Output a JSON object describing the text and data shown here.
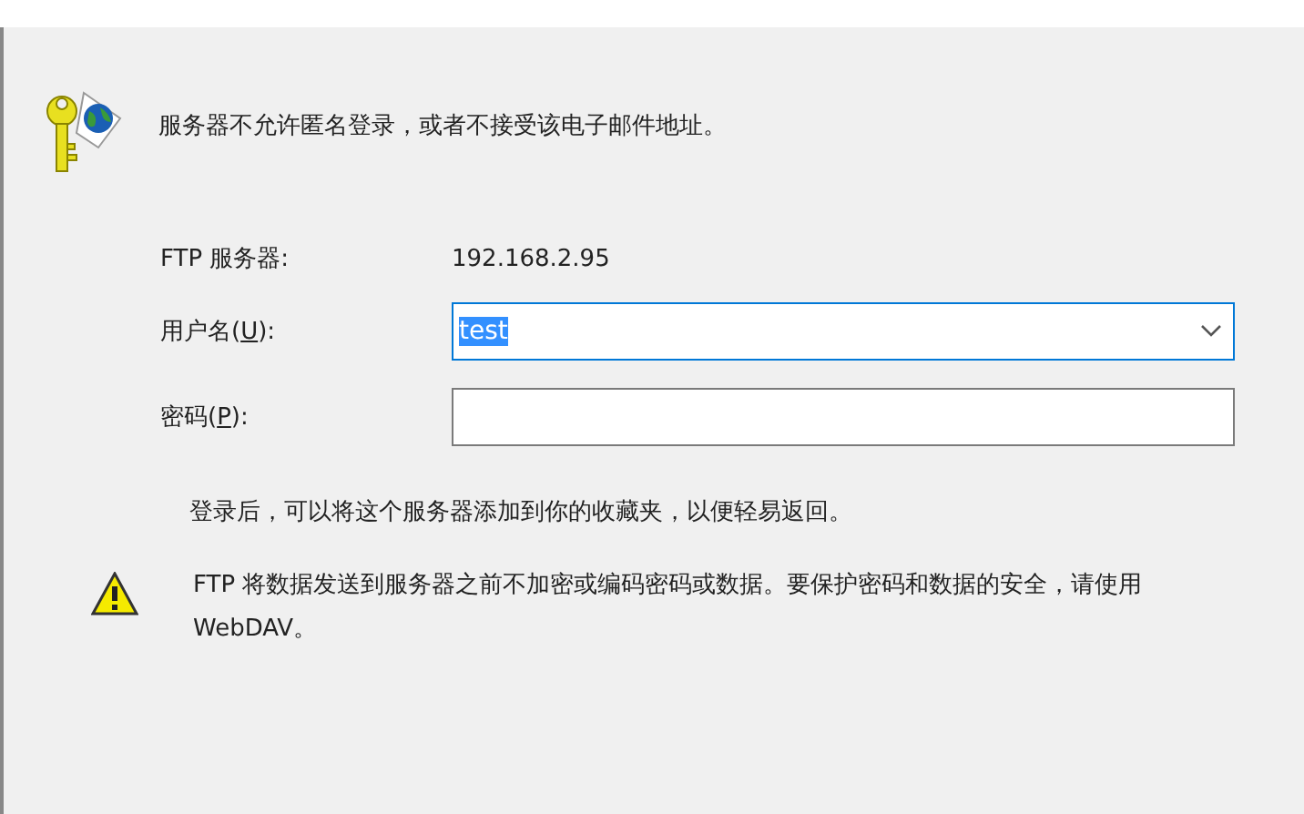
{
  "message": "服务器不允许匿名登录，或者不接受该电子邮件地址。",
  "server": {
    "label": "FTP 服务器:",
    "value": "192.168.2.95"
  },
  "fields": [
    {
      "kind": "combo",
      "label_before": "用户名(",
      "access_key": "U",
      "label_after": "):",
      "value": "test",
      "selected": true
    },
    {
      "kind": "password",
      "label_before": "密码(",
      "access_key": "P",
      "label_after": "):"
    }
  ],
  "info": "登录后，可以将这个服务器添加到你的收藏夹，以便轻易返回。",
  "warning": "FTP 将数据发送到服务器之前不加密或编码密码或数据。要保护密码和数据的安全，请使用 WebDAV。"
}
